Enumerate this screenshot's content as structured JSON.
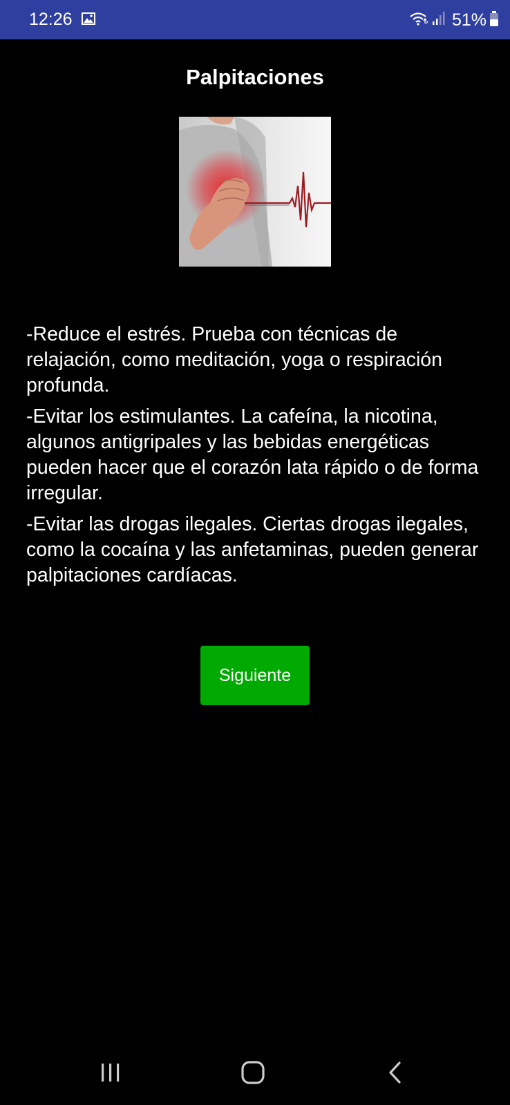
{
  "status_bar": {
    "time": "12:26",
    "battery": "51%",
    "bg_color": "#2f3fa0",
    "icons": [
      "gallery-icon",
      "wifi-icon",
      "signal-icon",
      "battery-icon"
    ]
  },
  "screen": {
    "title": "Palpitaciones",
    "image_alt": "heart-pain-illustration",
    "tips": [
      "-Reduce el estrés. Prueba con técnicas de relajación, como meditación, yoga o respiración profunda.",
      "-Evitar los estimulantes. La cafeína, la nicotina, algunos antigripales y las bebidas energéticas pueden hacer que el corazón lata rápido o de forma irregular.",
      "-Evitar las drogas ilegales. Ciertas drogas ilegales, como la cocaína y las anfetaminas, pueden generar palpitaciones cardíacas."
    ],
    "next_button": "Siguiente",
    "button_color": "#00aa00"
  },
  "nav_bar": {
    "icons": [
      "recent-apps-icon",
      "home-icon",
      "back-icon"
    ]
  }
}
